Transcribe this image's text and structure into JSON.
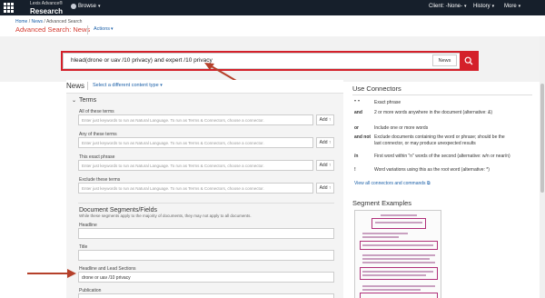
{
  "header": {
    "brand_line1": "Lexis Advance®",
    "brand_line2": "Research",
    "browse_label": "Browse",
    "client_label": "Client: -None-",
    "history_label": "History",
    "more_label": "More"
  },
  "breadcrumb": {
    "home": "Home",
    "news": "News",
    "current": "Advanced Search"
  },
  "page": {
    "title": "Advanced Search: News",
    "actions_label": "Actions"
  },
  "search": {
    "query": "hlead(drone or uav /10 privacy) and expert /10 privacy",
    "scope_label": "News"
  },
  "left": {
    "news_heading": "News",
    "content_type_link": "Select a different content type",
    "terms_heading": "Terms",
    "fields": [
      {
        "label": "All of these terms",
        "placeholder": "Enter just keywords to run as Natural Language. To run as Terms & Connectors, choose a connector.",
        "add": "Add"
      },
      {
        "label": "Any of these terms",
        "placeholder": "Enter just keywords to run as Natural Language. To run as Terms & Connectors, choose a connector.",
        "add": "Add"
      },
      {
        "label": "This exact phrase",
        "placeholder": "Enter just keywords to run as Natural Language. To run as Terms & Connectors, choose a connector.",
        "add": "Add"
      },
      {
        "label": "Exclude these terms",
        "placeholder": "Enter just keywords to run as Natural Language. To run as Terms & Connectors, choose a connector.",
        "add": "Add"
      }
    ],
    "segments_heading": "Document Segments/Fields",
    "segments_desc": "While these segments apply to the majority of documents, they may not apply to all documents.",
    "segments": [
      {
        "label": "Headline",
        "value": ""
      },
      {
        "label": "Title",
        "value": ""
      },
      {
        "label": "Headline and Lead Sections",
        "value": "drone or uav /10 privacy"
      },
      {
        "label": "Publication",
        "value": ""
      }
    ]
  },
  "right": {
    "connectors_title": "Use Connectors",
    "connectors": [
      {
        "op": "\" \"",
        "desc": "Exact phrase"
      },
      {
        "op": "and",
        "desc": "2 or more words anywhere in the document (alternative: &)"
      },
      {
        "op": "or",
        "desc": "Include one or more words"
      },
      {
        "op": "and not",
        "desc": "Exclude documents containing the word or phrase; should be the last connector, or may produce unexpected results"
      },
      {
        "op": "/n",
        "desc": "First word within \"n\" words of the second (alternative: w/n or near/n)"
      },
      {
        "op": "!",
        "desc": "Word variations using this as the root word (alternative: *)"
      }
    ],
    "view_all": "View all connectors and commands",
    "segment_examples_title": "Segment Examples"
  },
  "colors": {
    "accent_red": "#d4202a",
    "link_blue": "#1a5fa8",
    "topbar": "#161f2b",
    "annotation_arrow": "#b5402a"
  }
}
